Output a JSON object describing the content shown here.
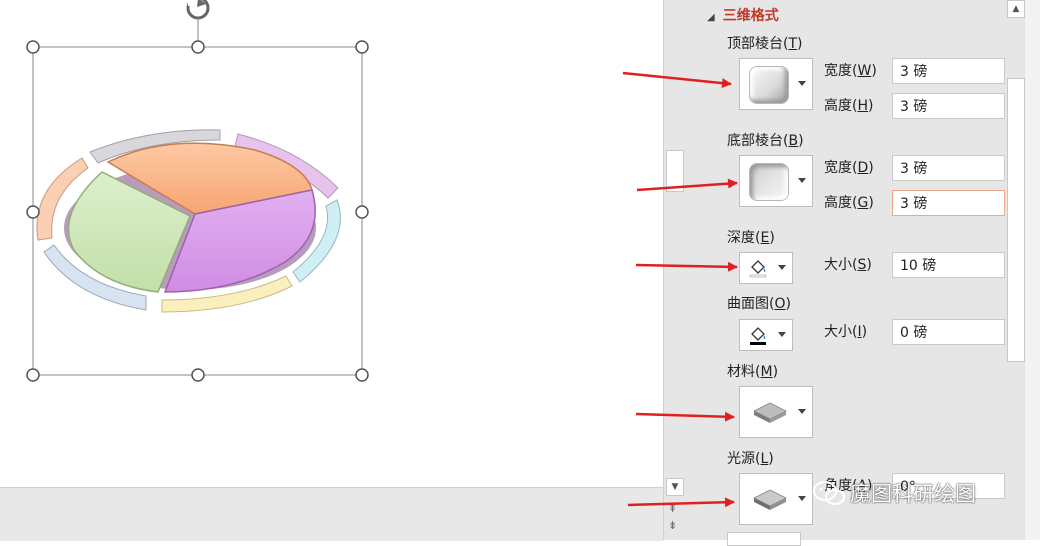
{
  "panel": {
    "section_title": "三维格式",
    "top_bevel": {
      "label": "顶部棱台(",
      "key": "T",
      "close": ")",
      "width_label": "宽度(",
      "width_key": "W",
      "width_value": "3 磅",
      "height_label": "高度(",
      "height_key": "H",
      "height_value": "3 磅"
    },
    "bottom_bevel": {
      "label": "底部棱台(",
      "key": "B",
      "close": ")",
      "width_label": "宽度(",
      "width_key": "D",
      "width_value": "3 磅",
      "height_label": "高度(",
      "height_key": "G",
      "height_value": "3 磅"
    },
    "depth": {
      "label": "深度(",
      "key": "E",
      "close": ")",
      "size_label": "大小(",
      "size_key": "S",
      "size_value": "10 磅"
    },
    "contour": {
      "label": "曲面图(",
      "key": "O",
      "close": ")",
      "size_label": "大小(",
      "size_key": "I",
      "size_value": "0 磅"
    },
    "material": {
      "label": "材料(",
      "key": "M",
      "close": ")"
    },
    "lighting": {
      "label": "光源(",
      "key": "L",
      "close": ")",
      "angle_label": "角度(",
      "angle_key": "A",
      "angle_value": "0°"
    },
    "close_paren": ")"
  },
  "watermark": "魔图科研绘图",
  "colors": {
    "section_title": "#c0392b",
    "arrow": "#e02020",
    "slice_orange": "#f9b487",
    "slice_purple": "#d79ae8",
    "slice_green": "#cde6b8"
  },
  "icons": [
    "rotate-handle-icon",
    "bevel-preset-icon",
    "fill-bucket-icon",
    "material-preset-icon",
    "lighting-preset-icon",
    "wechat-icon",
    "collapse-triangle-icon"
  ]
}
